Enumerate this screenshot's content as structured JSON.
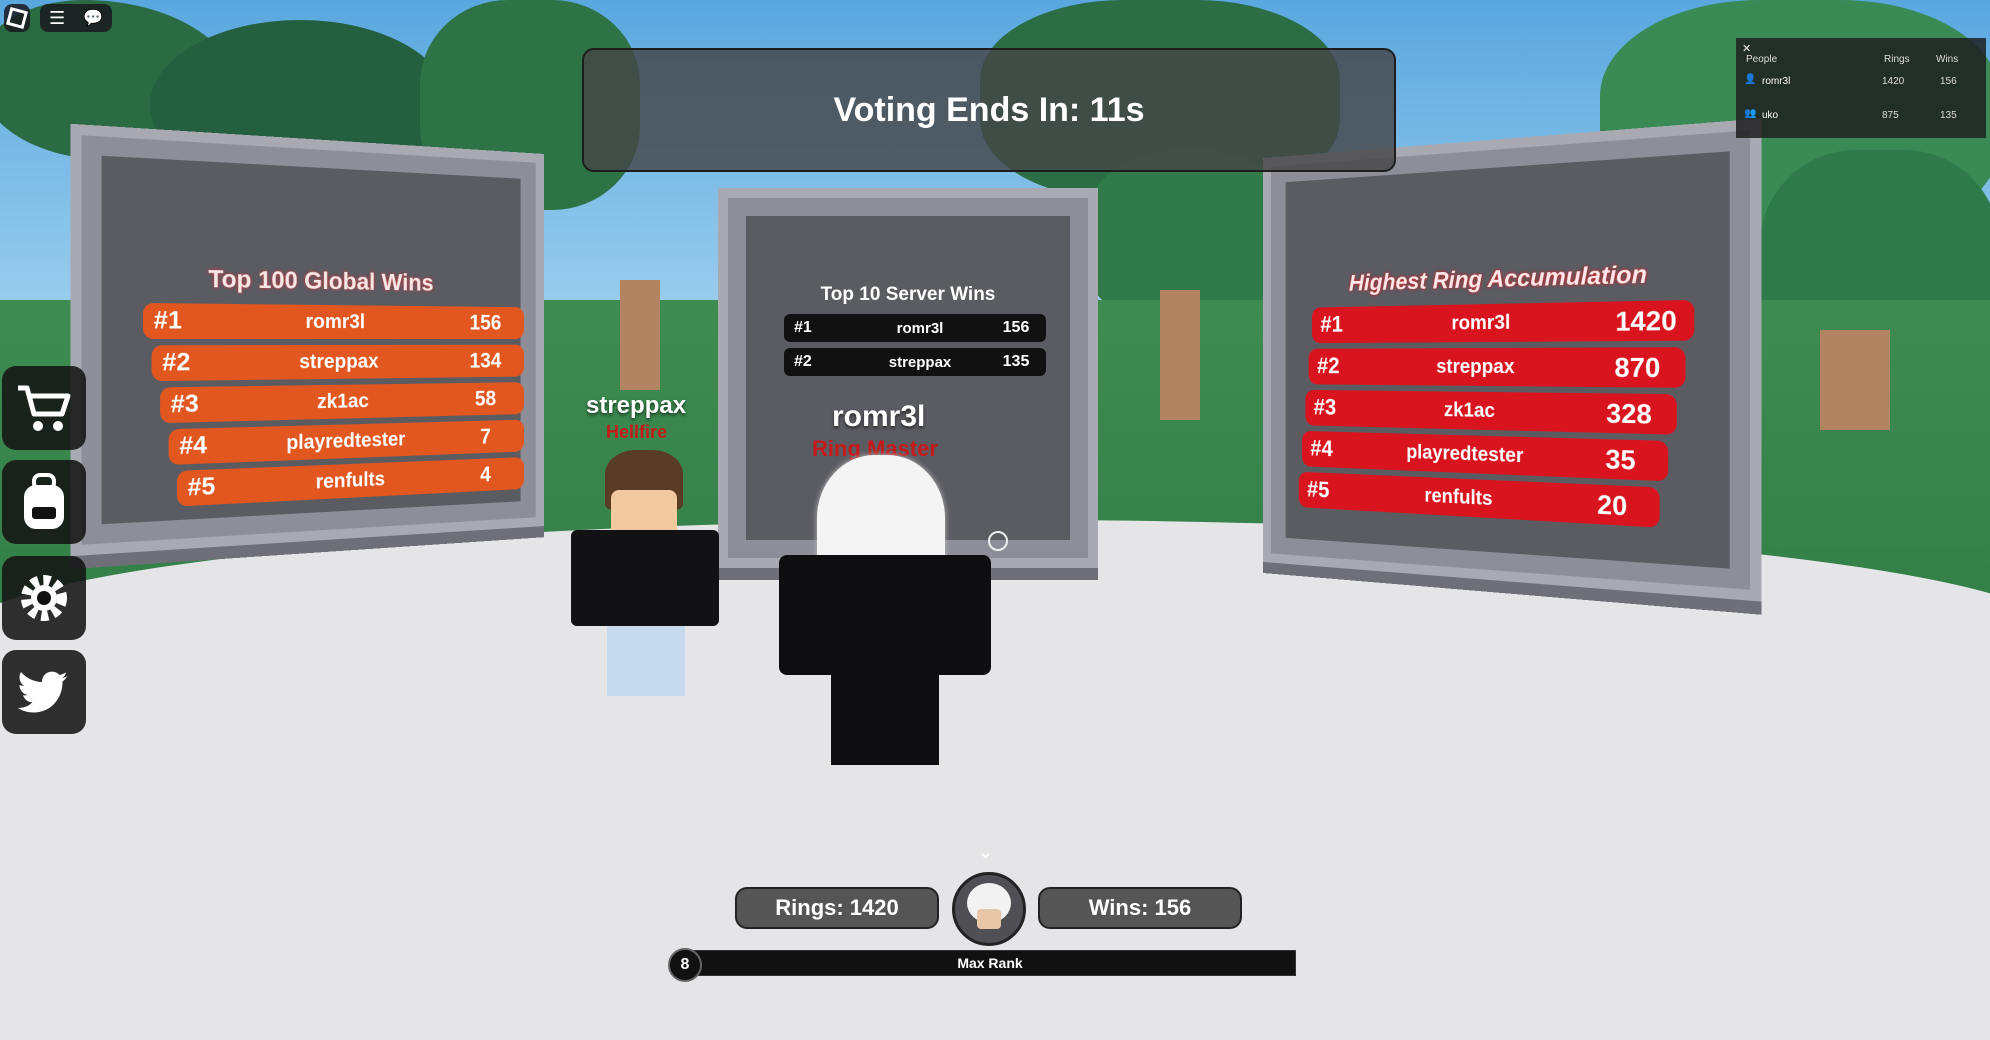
{
  "hud": {
    "voting_text": "Voting Ends In: 11s",
    "menu_icons": [
      "roblox-logo-icon",
      "hamburger-menu-icon",
      "chat-icon"
    ],
    "side_buttons": [
      "shop-cart-icon",
      "backpack-icon",
      "gear-icon",
      "twitter-icon"
    ],
    "rings_label": "Rings: 1420",
    "wins_label": "Wins: 156",
    "level": "8",
    "rank_text": "Max Rank",
    "rank_progress": 1.0
  },
  "player_list": {
    "headers": {
      "people": "People",
      "rings": "Rings",
      "wins": "Wins"
    },
    "close": "✕",
    "players": [
      {
        "name": "romr3l",
        "rings": "1420",
        "wins": "156"
      },
      {
        "name": "uko",
        "rings": "875",
        "wins": "135"
      }
    ]
  },
  "boards": {
    "global": {
      "title": "Top 100 Global Wins",
      "rows": [
        {
          "rank": "#1",
          "name": "romr3l",
          "value": "156"
        },
        {
          "rank": "#2",
          "name": "streppax",
          "value": "134"
        },
        {
          "rank": "#3",
          "name": "zk1ac",
          "value": "58"
        },
        {
          "rank": "#4",
          "name": "playredtester",
          "value": "7"
        },
        {
          "rank": "#5",
          "name": "renfults",
          "value": "4"
        }
      ]
    },
    "server": {
      "title": "Top 10 Server Wins",
      "rows": [
        {
          "rank": "#1",
          "name": "romr3l",
          "value": "156"
        },
        {
          "rank": "#2",
          "name": "streppax",
          "value": "135"
        }
      ]
    },
    "rings": {
      "title": "Highest Ring Accumulation",
      "rows": [
        {
          "rank": "#1",
          "name": "romr3l",
          "value": "1420"
        },
        {
          "rank": "#2",
          "name": "streppax",
          "value": "870"
        },
        {
          "rank": "#3",
          "name": "zk1ac",
          "value": "328"
        },
        {
          "rank": "#4",
          "name": "playredtester",
          "value": "35"
        },
        {
          "rank": "#5",
          "name": "renfults",
          "value": "20"
        }
      ]
    }
  },
  "characters": {
    "other": {
      "name": "streppax",
      "title": "Hellfire"
    },
    "self": {
      "name": "romr3l",
      "title": "Ring Master"
    }
  },
  "colors": {
    "orange_row": "#e2561f",
    "red_row": "#d9141e",
    "title_red": "#c51a1a"
  }
}
